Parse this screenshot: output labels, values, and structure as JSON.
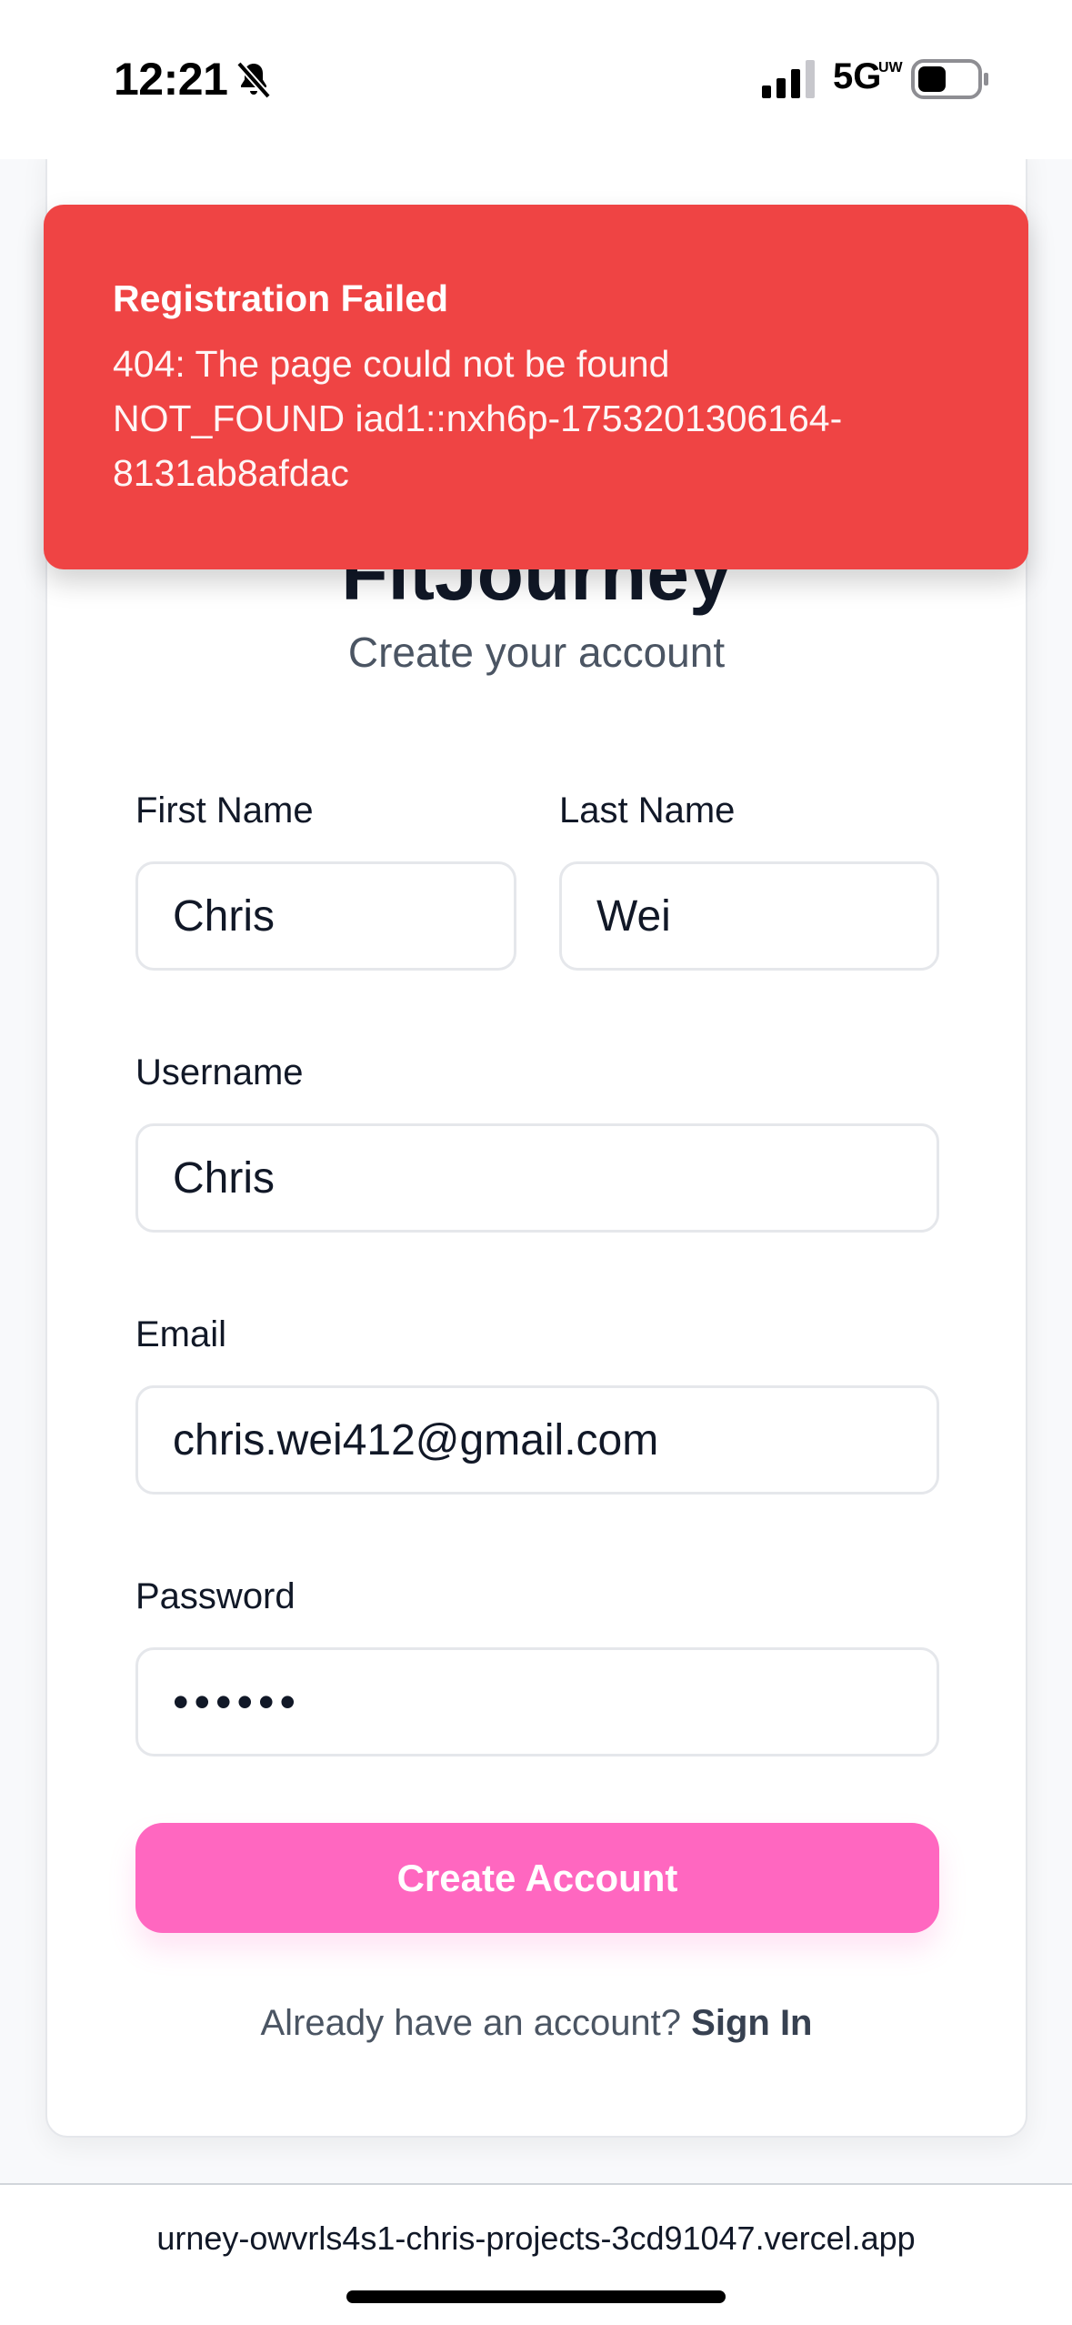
{
  "status_bar": {
    "time": "12:21",
    "network": "5G",
    "network_sup": "UW"
  },
  "toast": {
    "title": "Registration Failed",
    "lines": [
      "404: The page could not be found",
      "NOT_FOUND iad1::nxh6p-1753201306164-",
      "8131ab8afdac"
    ]
  },
  "card": {
    "title": "FitJourney",
    "subtitle": "Create your account"
  },
  "form": {
    "first_name": {
      "label": "First Name",
      "value": "Chris"
    },
    "last_name": {
      "label": "Last Name",
      "value": "Wei"
    },
    "username": {
      "label": "Username",
      "value": "Chris"
    },
    "email": {
      "label": "Email",
      "value": "chris.wei412@gmail.com"
    },
    "password": {
      "label": "Password",
      "value": "••••••"
    },
    "submit_label": "Create Account",
    "signin_prompt": "Already have an account?",
    "signin_link": "Sign In"
  },
  "browser": {
    "url": "urney-owvrls4s1-chris-projects-3cd91047.vercel.app"
  },
  "colors": {
    "toast_bg": "#ef4444",
    "button_bg": "#ff67c0"
  }
}
